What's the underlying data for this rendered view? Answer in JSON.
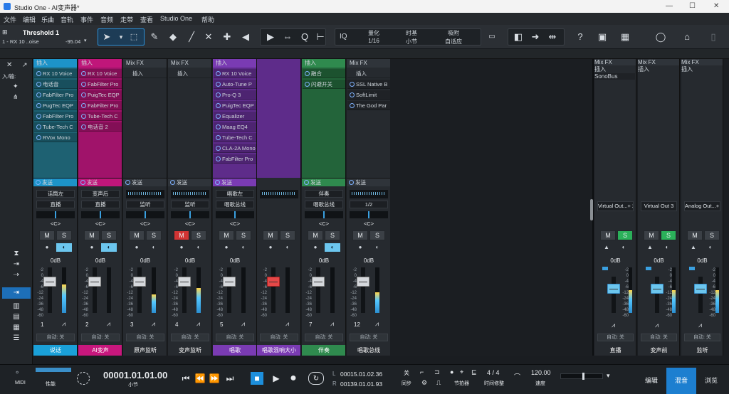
{
  "window": {
    "title": "Studio One - AI变声器*",
    "controls": [
      "—",
      "☐",
      "✕"
    ]
  },
  "menu": [
    "文件",
    "编辑",
    "乐曲",
    "音轨",
    "事件",
    "音频",
    "走带",
    "查看",
    "Studio One",
    "帮助"
  ],
  "toolbar": {
    "inspector_title": "Threshold 1",
    "inspector_sub": "1 - RX 10 ..oise",
    "inspector_val": "-95.04",
    "tools": [
      "pointer-icon",
      "range-icon",
      "pencil-icon",
      "eraser-icon",
      "paint-icon",
      "mute-icon",
      "split-icon",
      "speaker-icon"
    ],
    "iq": "IQ",
    "quantize_label": "量化",
    "quantize_value": "1/16",
    "timebase_label": "时基",
    "timebase_value": "小节",
    "snap_label": "吸附",
    "snap_value": "自适应"
  },
  "left_panel": {
    "io_label": "入/输:"
  },
  "channels": [
    {
      "header": "插入",
      "header_color": "#1d93c8",
      "body_color": "#1e6172",
      "inserts": [
        "RX 10 Voice",
        "电话音",
        "FabFilter Pro",
        "PugTec EQP",
        "FabFilter Pro",
        "Tube-Tech C",
        "RVox Mono"
      ],
      "send": "发送",
      "input": "话筒左",
      "output": "直播",
      "pan": "<C>",
      "db": "0dB",
      "number": "1",
      "auto": "自动: 关",
      "name": "说话",
      "name_color": "#1aa0d8",
      "mute_active": false,
      "solo_active": false,
      "monitor_active": true,
      "level": 0.62
    },
    {
      "header": "插入",
      "header_color": "#c0167a",
      "body_color": "#a0136a",
      "inserts": [
        "RX 10 Voice",
        "FabFilter Pro",
        "PuigTec EQP",
        "FabFilter Pro",
        "Tube-Tech C",
        "电话音 2"
      ],
      "send": "发送",
      "input": "变声后",
      "output": "直播",
      "pan": "<C>",
      "db": "0dB",
      "number": "2",
      "auto": "自动: 关",
      "name": "AI变声",
      "name_color": "#c8177d",
      "mute_active": false,
      "solo_active": false,
      "monitor_active": true,
      "level": 0.0
    },
    {
      "header": "Mix FX",
      "header_color": "#2f343a",
      "body_color": "#262a2f",
      "inserts": [
        "插入"
      ],
      "send": "发送",
      "input": "",
      "output": "监听",
      "pan": "<C>",
      "db": "0dB",
      "number": "3",
      "auto": "自动: 关",
      "name": "原声监听",
      "name_color": "#262a2f",
      "mute_active": false,
      "solo_active": false,
      "monitor_active": false,
      "level": 0.4
    },
    {
      "header": "Mix FX",
      "header_color": "#2f343a",
      "body_color": "#262a2f",
      "inserts": [
        "插入"
      ],
      "send": "发送",
      "input": "",
      "output": "监听",
      "pan": "<C>",
      "db": "0dB",
      "number": "4",
      "auto": "自动: 关",
      "name": "变声监听",
      "name_color": "#262a2f",
      "mute_active": true,
      "solo_active": false,
      "monitor_active": false,
      "level": 0.55
    },
    {
      "header": "插入",
      "header_color": "#7a3bb3",
      "body_color": "#5e2c8a",
      "inserts": [
        "RX 10 Voice",
        "Auto-Tune P",
        "Pro-Q 3",
        "PuigTec EQP",
        "Equalizer",
        "Maag EQ4",
        "Tube-Tech C",
        "CLA-2A Mono",
        "FabFilter Pro"
      ],
      "send": "发送",
      "input": "唱歌左",
      "output": "唱歌总线",
      "pan": "<C>",
      "db": "0dB",
      "number": "5",
      "auto": "自动: 关",
      "name": "唱歌",
      "name_color": "#7a3bb3",
      "mute_active": false,
      "solo_active": false,
      "monitor_active": false,
      "level": 0.0
    },
    {
      "header": "",
      "header_color": "#5e2c8a",
      "body_color": "#5e2c8a",
      "inserts": [],
      "send": "",
      "input": "",
      "output": "",
      "pan": "",
      "db": "",
      "number": "",
      "auto": "自动: 关",
      "name": "唱歌混响大小",
      "name_color": "#7a3bb3",
      "mute_active": false,
      "solo_active": false,
      "monitor_active": false,
      "level": 0.0,
      "red_fader": true
    },
    {
      "header": "插入",
      "header_color": "#2f8a4e",
      "body_color": "#23643a",
      "inserts": [
        "融合",
        "闪避开关"
      ],
      "send": "发送",
      "input": "伴奏",
      "output": "唱歌总线",
      "pan": "<C>",
      "db": "0dB",
      "number": "7",
      "auto": "自动: 关",
      "name": "伴奏",
      "name_color": "#2f8a4e",
      "mute_active": false,
      "solo_active": false,
      "monitor_active": true,
      "level": 0.0
    },
    {
      "header": "Mix FX",
      "header_color": "#2f343a",
      "body_color": "#262a2f",
      "inserts": [
        "插入",
        "SSL Native B",
        "SoftLimit",
        "The God Par"
      ],
      "send": "发送",
      "input": "",
      "output": "1/2",
      "pan": "<C>",
      "db": "0dB",
      "number": "12",
      "auto": "自动: 关",
      "name": "唱歌总线",
      "name_color": "#262a2f",
      "mute_active": false,
      "solo_active": false,
      "monitor_active": false,
      "level": 0.45
    }
  ],
  "fx_channels": [
    {
      "header": "Mix FX",
      "inserts": [
        "插入",
        "SonoBus"
      ],
      "output": "Virtual Out...+ 2",
      "db": "0dB",
      "auto": "自动: 关",
      "name": "直播",
      "solo_active": true,
      "level": 0.5
    },
    {
      "header": "Mix FX",
      "inserts": [
        "插入"
      ],
      "output": "Virtual Out 3",
      "db": "0dB",
      "auto": "自动: 关",
      "name": "变声前",
      "solo_active": true,
      "level": 0.5
    },
    {
      "header": "Mix FX",
      "inserts": [
        "插入"
      ],
      "output": "Analog Out...+ 2",
      "db": "0dB",
      "auto": "自动: 关",
      "name": "监听",
      "solo_active": false,
      "level": 0.5
    }
  ],
  "scale_labels": [
    "-2",
    "0",
    "-4",
    "-6",
    "-12",
    "-24",
    "-36",
    "-48",
    "-60"
  ],
  "transport": {
    "midi": "MIDI",
    "perf": "性能",
    "time": "00001.01.01.00",
    "time_unit": "小节",
    "loop_l": "00015.01.02.36",
    "loop_r": "00139.01.01.93",
    "sync": "关",
    "sync_label": "同步",
    "metronome_label": "节拍器",
    "signature": "4 / 4",
    "signature_label": "时间修整",
    "tempo": "120.00",
    "tempo_label": "速度"
  },
  "nav_tabs": [
    "编辑",
    "混音",
    "浏览"
  ]
}
